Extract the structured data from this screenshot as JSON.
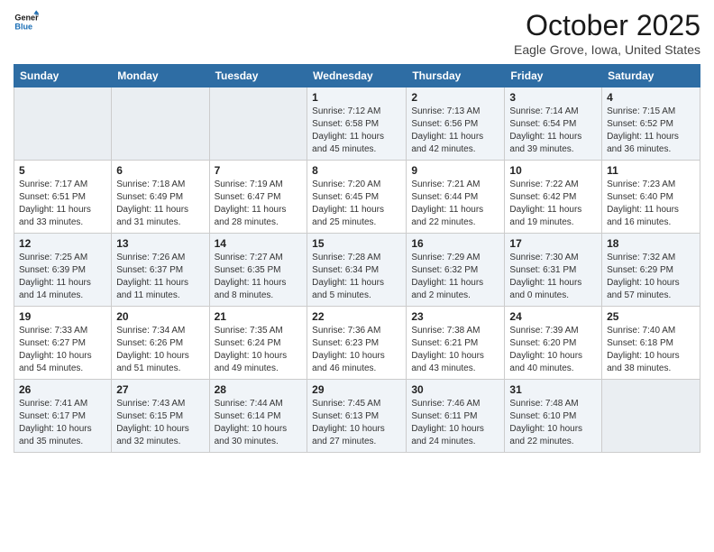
{
  "logo": {
    "line1": "General",
    "line2": "Blue"
  },
  "title": "October 2025",
  "subtitle": "Eagle Grove, Iowa, United States",
  "days_of_week": [
    "Sunday",
    "Monday",
    "Tuesday",
    "Wednesday",
    "Thursday",
    "Friday",
    "Saturday"
  ],
  "weeks": [
    [
      {
        "day": "",
        "info": ""
      },
      {
        "day": "",
        "info": ""
      },
      {
        "day": "",
        "info": ""
      },
      {
        "day": "1",
        "info": "Sunrise: 7:12 AM\nSunset: 6:58 PM\nDaylight: 11 hours\nand 45 minutes."
      },
      {
        "day": "2",
        "info": "Sunrise: 7:13 AM\nSunset: 6:56 PM\nDaylight: 11 hours\nand 42 minutes."
      },
      {
        "day": "3",
        "info": "Sunrise: 7:14 AM\nSunset: 6:54 PM\nDaylight: 11 hours\nand 39 minutes."
      },
      {
        "day": "4",
        "info": "Sunrise: 7:15 AM\nSunset: 6:52 PM\nDaylight: 11 hours\nand 36 minutes."
      }
    ],
    [
      {
        "day": "5",
        "info": "Sunrise: 7:17 AM\nSunset: 6:51 PM\nDaylight: 11 hours\nand 33 minutes."
      },
      {
        "day": "6",
        "info": "Sunrise: 7:18 AM\nSunset: 6:49 PM\nDaylight: 11 hours\nand 31 minutes."
      },
      {
        "day": "7",
        "info": "Sunrise: 7:19 AM\nSunset: 6:47 PM\nDaylight: 11 hours\nand 28 minutes."
      },
      {
        "day": "8",
        "info": "Sunrise: 7:20 AM\nSunset: 6:45 PM\nDaylight: 11 hours\nand 25 minutes."
      },
      {
        "day": "9",
        "info": "Sunrise: 7:21 AM\nSunset: 6:44 PM\nDaylight: 11 hours\nand 22 minutes."
      },
      {
        "day": "10",
        "info": "Sunrise: 7:22 AM\nSunset: 6:42 PM\nDaylight: 11 hours\nand 19 minutes."
      },
      {
        "day": "11",
        "info": "Sunrise: 7:23 AM\nSunset: 6:40 PM\nDaylight: 11 hours\nand 16 minutes."
      }
    ],
    [
      {
        "day": "12",
        "info": "Sunrise: 7:25 AM\nSunset: 6:39 PM\nDaylight: 11 hours\nand 14 minutes."
      },
      {
        "day": "13",
        "info": "Sunrise: 7:26 AM\nSunset: 6:37 PM\nDaylight: 11 hours\nand 11 minutes."
      },
      {
        "day": "14",
        "info": "Sunrise: 7:27 AM\nSunset: 6:35 PM\nDaylight: 11 hours\nand 8 minutes."
      },
      {
        "day": "15",
        "info": "Sunrise: 7:28 AM\nSunset: 6:34 PM\nDaylight: 11 hours\nand 5 minutes."
      },
      {
        "day": "16",
        "info": "Sunrise: 7:29 AM\nSunset: 6:32 PM\nDaylight: 11 hours\nand 2 minutes."
      },
      {
        "day": "17",
        "info": "Sunrise: 7:30 AM\nSunset: 6:31 PM\nDaylight: 11 hours\nand 0 minutes."
      },
      {
        "day": "18",
        "info": "Sunrise: 7:32 AM\nSunset: 6:29 PM\nDaylight: 10 hours\nand 57 minutes."
      }
    ],
    [
      {
        "day": "19",
        "info": "Sunrise: 7:33 AM\nSunset: 6:27 PM\nDaylight: 10 hours\nand 54 minutes."
      },
      {
        "day": "20",
        "info": "Sunrise: 7:34 AM\nSunset: 6:26 PM\nDaylight: 10 hours\nand 51 minutes."
      },
      {
        "day": "21",
        "info": "Sunrise: 7:35 AM\nSunset: 6:24 PM\nDaylight: 10 hours\nand 49 minutes."
      },
      {
        "day": "22",
        "info": "Sunrise: 7:36 AM\nSunset: 6:23 PM\nDaylight: 10 hours\nand 46 minutes."
      },
      {
        "day": "23",
        "info": "Sunrise: 7:38 AM\nSunset: 6:21 PM\nDaylight: 10 hours\nand 43 minutes."
      },
      {
        "day": "24",
        "info": "Sunrise: 7:39 AM\nSunset: 6:20 PM\nDaylight: 10 hours\nand 40 minutes."
      },
      {
        "day": "25",
        "info": "Sunrise: 7:40 AM\nSunset: 6:18 PM\nDaylight: 10 hours\nand 38 minutes."
      }
    ],
    [
      {
        "day": "26",
        "info": "Sunrise: 7:41 AM\nSunset: 6:17 PM\nDaylight: 10 hours\nand 35 minutes."
      },
      {
        "day": "27",
        "info": "Sunrise: 7:43 AM\nSunset: 6:15 PM\nDaylight: 10 hours\nand 32 minutes."
      },
      {
        "day": "28",
        "info": "Sunrise: 7:44 AM\nSunset: 6:14 PM\nDaylight: 10 hours\nand 30 minutes."
      },
      {
        "day": "29",
        "info": "Sunrise: 7:45 AM\nSunset: 6:13 PM\nDaylight: 10 hours\nand 27 minutes."
      },
      {
        "day": "30",
        "info": "Sunrise: 7:46 AM\nSunset: 6:11 PM\nDaylight: 10 hours\nand 24 minutes."
      },
      {
        "day": "31",
        "info": "Sunrise: 7:48 AM\nSunset: 6:10 PM\nDaylight: 10 hours\nand 22 minutes."
      },
      {
        "day": "",
        "info": ""
      }
    ]
  ]
}
